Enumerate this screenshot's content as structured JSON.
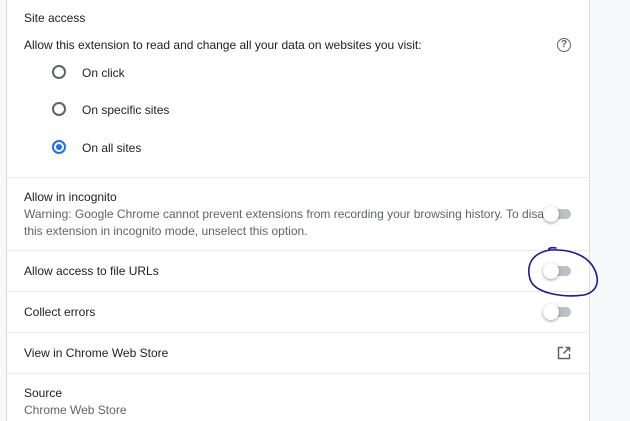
{
  "site_access": {
    "heading": "Site access",
    "description": "Allow this extension to read and change all your data on websites you visit:",
    "help_icon": "?",
    "options": [
      {
        "label": "On click",
        "checked": false
      },
      {
        "label": "On specific sites",
        "checked": false
      },
      {
        "label": "On all sites",
        "checked": true
      }
    ]
  },
  "incognito": {
    "title": "Allow in incognito",
    "warning_line1": "Warning: Google Chrome cannot prevent extensions from recording your browsing history. To disable",
    "warning_line2": "this extension in incognito mode, unselect this option.",
    "enabled": false
  },
  "file_urls": {
    "title": "Allow access to file URLs",
    "enabled": false
  },
  "collect_errors": {
    "title": "Collect errors",
    "enabled": false
  },
  "web_store": {
    "title": "View in Chrome Web Store",
    "icon": "open-in-new-icon"
  },
  "source": {
    "title": "Source",
    "value": "Chrome Web Store"
  },
  "colors": {
    "accent": "#1a73e8",
    "annotation": "#1a1a8c",
    "toggle_off_track": "#bdc1c6"
  }
}
